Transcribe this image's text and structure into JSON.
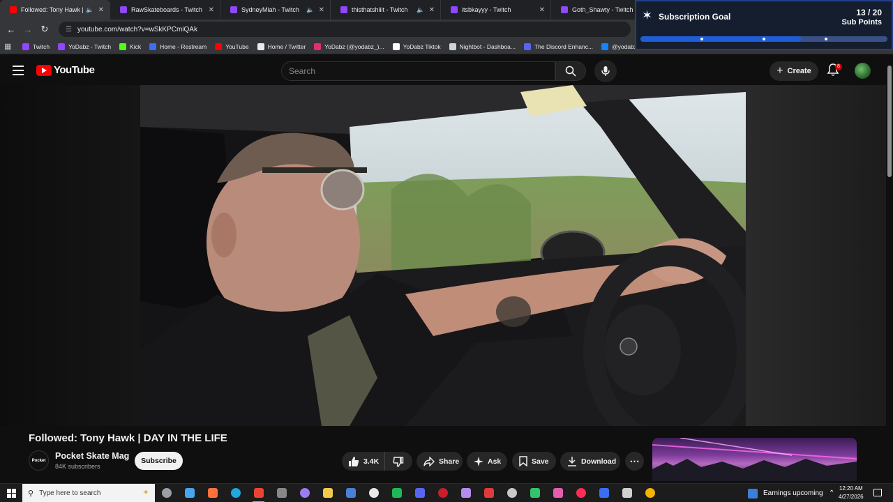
{
  "browser": {
    "tabs": [
      {
        "title": "Followed: Tony Hawk | DAY",
        "active": true,
        "icon": "youtube-icon",
        "color": "#ff0000",
        "audio": true
      },
      {
        "title": "RawSkateboards - Twitch",
        "active": false,
        "icon": "twitch-icon",
        "color": "#9146ff",
        "audio": false
      },
      {
        "title": "SydneyMiah - Twitch",
        "active": false,
        "icon": "twitch-icon",
        "color": "#9146ff",
        "audio": true
      },
      {
        "title": "thisthatshiiit - Twitch",
        "active": false,
        "icon": "twitch-icon",
        "color": "#9146ff",
        "audio": true
      },
      {
        "title": "itsbkayyy - Twitch",
        "active": false,
        "icon": "twitch-icon",
        "color": "#9146ff",
        "audio": false
      },
      {
        "title": "Goth_Shawty - Twitch",
        "active": false,
        "icon": "twitch-icon",
        "color": "#9146ff",
        "audio": false
      }
    ],
    "url": "youtube.com/watch?v=wSkKPCmiQAk",
    "bookmarks": [
      {
        "label": "Twitch",
        "color": "#9146ff"
      },
      {
        "label": "YoDabz - Twitch",
        "color": "#9146ff"
      },
      {
        "label": "Kick",
        "color": "#53fc18"
      },
      {
        "label": "Home - Restream",
        "color": "#3c6ef5"
      },
      {
        "label": "YouTube",
        "color": "#ff0000"
      },
      {
        "label": "Home / Twitter",
        "color": "#e8eaed"
      },
      {
        "label": "YoDabz (@yodabz_)...",
        "color": "#e1306c"
      },
      {
        "label": "YoDabz Tiktok",
        "color": "#ffffff"
      },
      {
        "label": "Nightbot - Dashboa...",
        "color": "#cfd4dc"
      },
      {
        "label": "The Discord Enhanc...",
        "color": "#5865f2"
      },
      {
        "label": "@yodabz.bsky.socia...",
        "color": "#1185fe"
      }
    ]
  },
  "subgoal": {
    "label": "Subscription Goal",
    "count": "13 / 20",
    "unit": "Sub Points",
    "progress": 0.65
  },
  "youtube": {
    "logo": "YouTube",
    "search_placeholder": "Search",
    "create_label": "Create",
    "notif_count": "8",
    "video": {
      "title": "Followed: Tony Hawk | DAY IN THE LIFE",
      "channel": "Pocket Skate Mag",
      "channel_avatar_text": "Pocket",
      "subscribers": "84K subscribers",
      "subscribe_label": "Subscribe",
      "likes": "3.4K",
      "share_label": "Share",
      "ask_label": "Ask",
      "save_label": "Save",
      "download_label": "Download"
    }
  },
  "taskbar": {
    "search_placeholder": "Type here to search",
    "apps": [
      "task-view-icon",
      "copilot-icon",
      "firefox-icon",
      "edge-icon",
      "chrome-icon",
      "obs-icon",
      "fingerprint-app-icon",
      "file-explorer-icon",
      "steam-icon",
      "epic-games-icon",
      "spotify-icon",
      "discord-icon",
      "red-app-icon",
      "feather-app-icon",
      "rockstar-icon",
      "stream-deck-icon",
      "green-app-icon",
      "color-wheel-icon",
      "tiktok-icon",
      "ps-remote-icon",
      "settings-icon",
      "yellow-app-icon"
    ],
    "news": "Earnings upcoming",
    "time": "12:20 AM",
    "date": "4/27/2026"
  }
}
